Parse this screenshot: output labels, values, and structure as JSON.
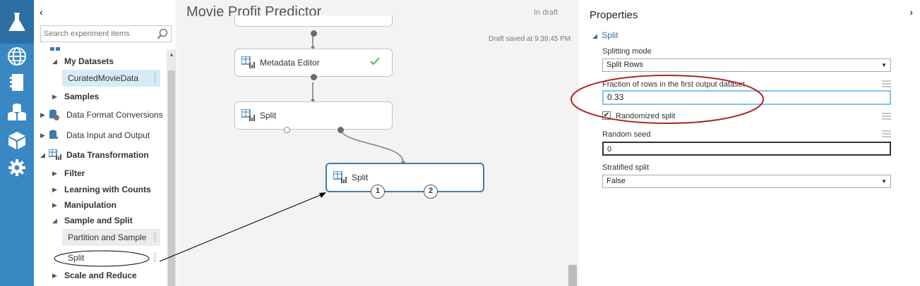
{
  "rail": {
    "icons": [
      "flask-icon",
      "globe-icon",
      "notebook-icon",
      "datasets-icon",
      "cube-icon",
      "gear-icon"
    ]
  },
  "items_panel": {
    "search_placeholder": "Search experiment items",
    "tree": [
      {
        "label": "My Datasets",
        "level": 1,
        "expanded": true,
        "bold": true
      },
      {
        "label": "CuratedMovieData",
        "level": 2,
        "leaf": true,
        "selected": true
      },
      {
        "label": "Samples",
        "level": 1,
        "expanded": false,
        "bold": true
      },
      {
        "label": "Data Format Conversions",
        "level": 0,
        "expanded": false
      },
      {
        "label": "Data Input and Output",
        "level": 0,
        "expanded": false
      },
      {
        "label": "Data Transformation",
        "level": 0,
        "expanded": true,
        "bold": true
      },
      {
        "label": "Filter",
        "level": 1,
        "expanded": false,
        "bold": true
      },
      {
        "label": "Learning with Counts",
        "level": 1,
        "expanded": false,
        "bold": true
      },
      {
        "label": "Manipulation",
        "level": 1,
        "expanded": false,
        "bold": true
      },
      {
        "label": "Sample and Split",
        "level": 1,
        "expanded": true,
        "bold": true
      },
      {
        "label": "Partition and Sample",
        "level": 2,
        "leaf": true
      },
      {
        "label": "Split",
        "level": 2,
        "leaf": true
      },
      {
        "label": "Scale and Reduce",
        "level": 1,
        "expanded": false,
        "bold": true
      }
    ]
  },
  "canvas": {
    "title": "Movie Profit Predictor",
    "status": "In draft",
    "saved": "Draft saved at 9:39:45 PM",
    "nodes": [
      {
        "label": "Metadata Editor"
      },
      {
        "label": "Split"
      },
      {
        "label": "Split",
        "outputs": [
          "1",
          "2"
        ]
      }
    ]
  },
  "properties": {
    "title": "Properties",
    "section": "Split",
    "splitting_mode_label": "Splitting mode",
    "splitting_mode_value": "Split Rows",
    "fraction_label": "Fraction of rows in the first output dataset",
    "fraction_value": "0.33",
    "randomized_label": "Randomized split",
    "randomized_checked": true,
    "seed_label": "Random seed",
    "seed_value": "0",
    "stratified_label": "Stratified split",
    "stratified_value": "False"
  },
  "colors": {
    "rail": "#3a88c3",
    "accent": "#2b6ea6",
    "annotation": "#b0252b",
    "success": "#5cb85c"
  }
}
